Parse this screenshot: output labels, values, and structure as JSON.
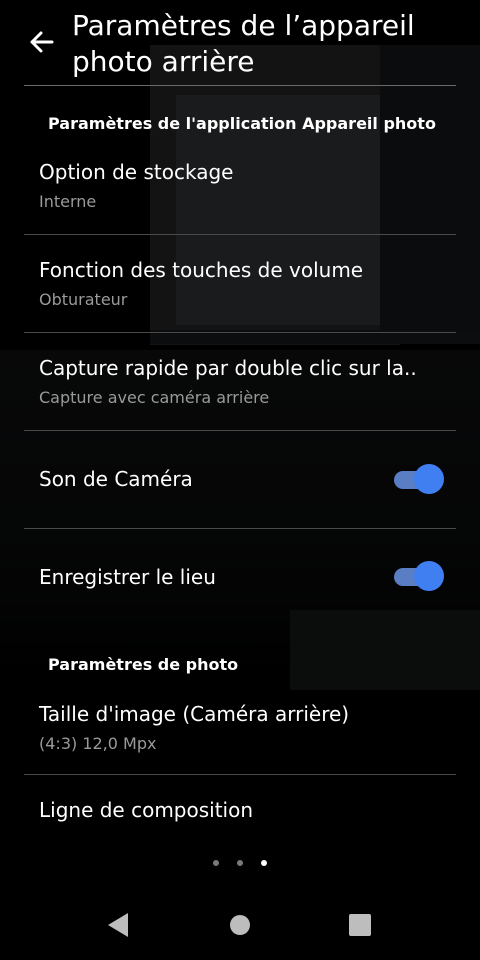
{
  "header": {
    "title": "Paramètres de l’appareil photo arrière"
  },
  "sections": [
    {
      "label": "Paramètres de l'application Appareil photo"
    },
    {
      "label": "Paramètres de photo"
    }
  ],
  "items": [
    {
      "title": "Option de stockage",
      "subtitle": "Interne"
    },
    {
      "title": "Fonction des touches de volume",
      "subtitle": "Obturateur"
    },
    {
      "title": "Capture rapide par double clic sur la..",
      "subtitle": "Capture avec caméra arrière"
    },
    {
      "title": "Son de Caméra",
      "toggle": true
    },
    {
      "title": "Enregistrer le lieu",
      "toggle": true
    },
    {
      "title": "Taille d'image (Caméra arrière)",
      "subtitle": "(4:3) 12,0 Mpx"
    },
    {
      "title": "Ligne de composition"
    }
  ],
  "pager": {
    "count": 3,
    "active_index": 2
  },
  "colors": {
    "toggle_on_knob": "#3f7ff2",
    "toggle_on_track": "#5a7ec4",
    "subtitle": "#9a9a9a"
  },
  "icons": {
    "back": "arrow-left-icon",
    "nav_back": "triangle-back-icon",
    "nav_home": "circle-home-icon",
    "nav_recents": "square-recents-icon"
  }
}
